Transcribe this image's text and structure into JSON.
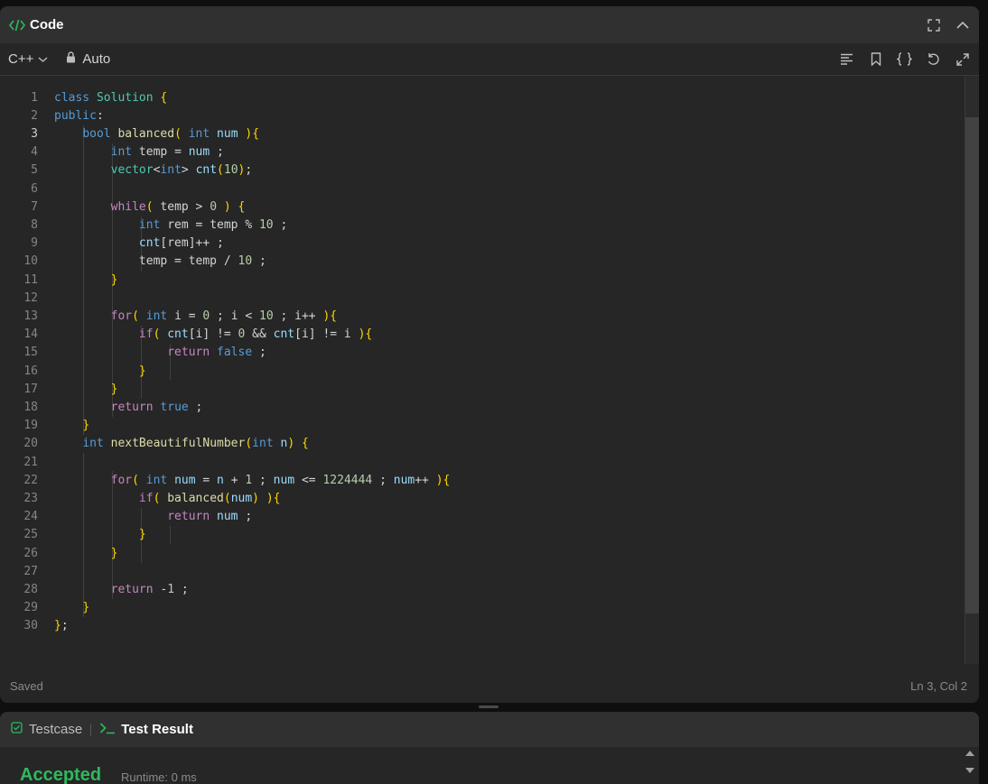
{
  "panel": {
    "title": "Code",
    "icon": "code-brackets-icon",
    "accent": "#2cbb5d"
  },
  "toolbar": {
    "language": "C++",
    "mode": "Auto"
  },
  "editor": {
    "active_line": 3,
    "line_numbers": [
      "1",
      "2",
      "3",
      "4",
      "5",
      "6",
      "7",
      "8",
      "9",
      "10",
      "11",
      "12",
      "13",
      "14",
      "15",
      "16",
      "17",
      "18",
      "19",
      "20",
      "21",
      "22",
      "23",
      "24",
      "25",
      "26",
      "27",
      "28",
      "29",
      "30"
    ],
    "lines": [
      "class Solution {",
      "public:",
      "    bool balanced( int num ){",
      "        int temp = num ;",
      "        vector<int> cnt(10);",
      "",
      "        while( temp > 0 ) {",
      "            int rem = temp % 10 ;",
      "            cnt[rem]++ ;",
      "            temp = temp / 10 ;",
      "        }",
      "",
      "        for( int i = 0 ; i < 10 ; i++ ){",
      "            if( cnt[i] != 0 && cnt[i] != i ){",
      "                return false ;",
      "            }",
      "        }",
      "        return true ;",
      "    }",
      "    int nextBeautifulNumber(int n) {",
      "",
      "        for( int num = n + 1 ; num <= 1224444 ; num++ ){",
      "            if( balanced(num) ){",
      "                return num ;",
      "            }",
      "        }",
      "",
      "        return -1 ;",
      "    }",
      "};"
    ]
  },
  "status": {
    "saved": "Saved",
    "position": "Ln 3, Col 2"
  },
  "bottom": {
    "tab_testcase": "Testcase",
    "tab_result": "Test Result",
    "result_status": "Accepted",
    "runtime": "Runtime: 0 ms"
  }
}
